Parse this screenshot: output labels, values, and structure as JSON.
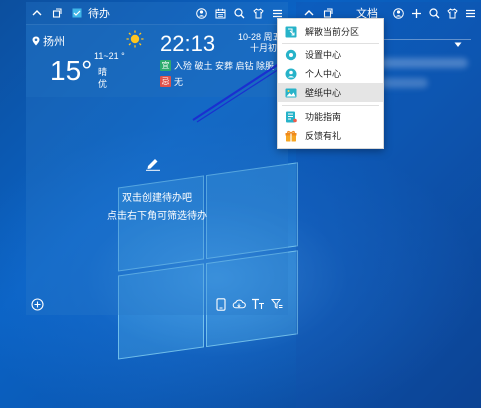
{
  "left_widget": {
    "title": "待办",
    "weather": {
      "city": "扬州",
      "temperature": "15°",
      "range": "11~21 °",
      "condition": "晴",
      "wind": "优"
    },
    "clock": {
      "time": "22:13",
      "date": "10-28 周五",
      "lunar": "十月初",
      "yi_label": "宜",
      "yi_text": "入殓 破土 安葬 启钻 除服",
      "ji_label": "忌",
      "ji_text": "无"
    },
    "todo": {
      "hint_line1": "双击创建待办吧",
      "hint_line2": "点击右下角可筛选待办"
    }
  },
  "right_widget": {
    "title": "文档"
  },
  "menu": {
    "items": [
      {
        "label": "解散当前分区",
        "icon": "ungroup-icon"
      },
      {
        "label": "设置中心",
        "icon": "settings-icon"
      },
      {
        "label": "个人中心",
        "icon": "user-icon"
      },
      {
        "label": "壁纸中心",
        "icon": "wallpaper-icon"
      },
      {
        "label": "功能指南",
        "icon": "guide-icon"
      },
      {
        "label": "反馈有礼",
        "icon": "gift-icon"
      }
    ],
    "active_index": 3
  },
  "colors": {
    "accent": "#1e88e5",
    "yi_tag": "#2eab6d",
    "ji_tag": "#e0524a",
    "arrow": "#1a2fd0"
  }
}
